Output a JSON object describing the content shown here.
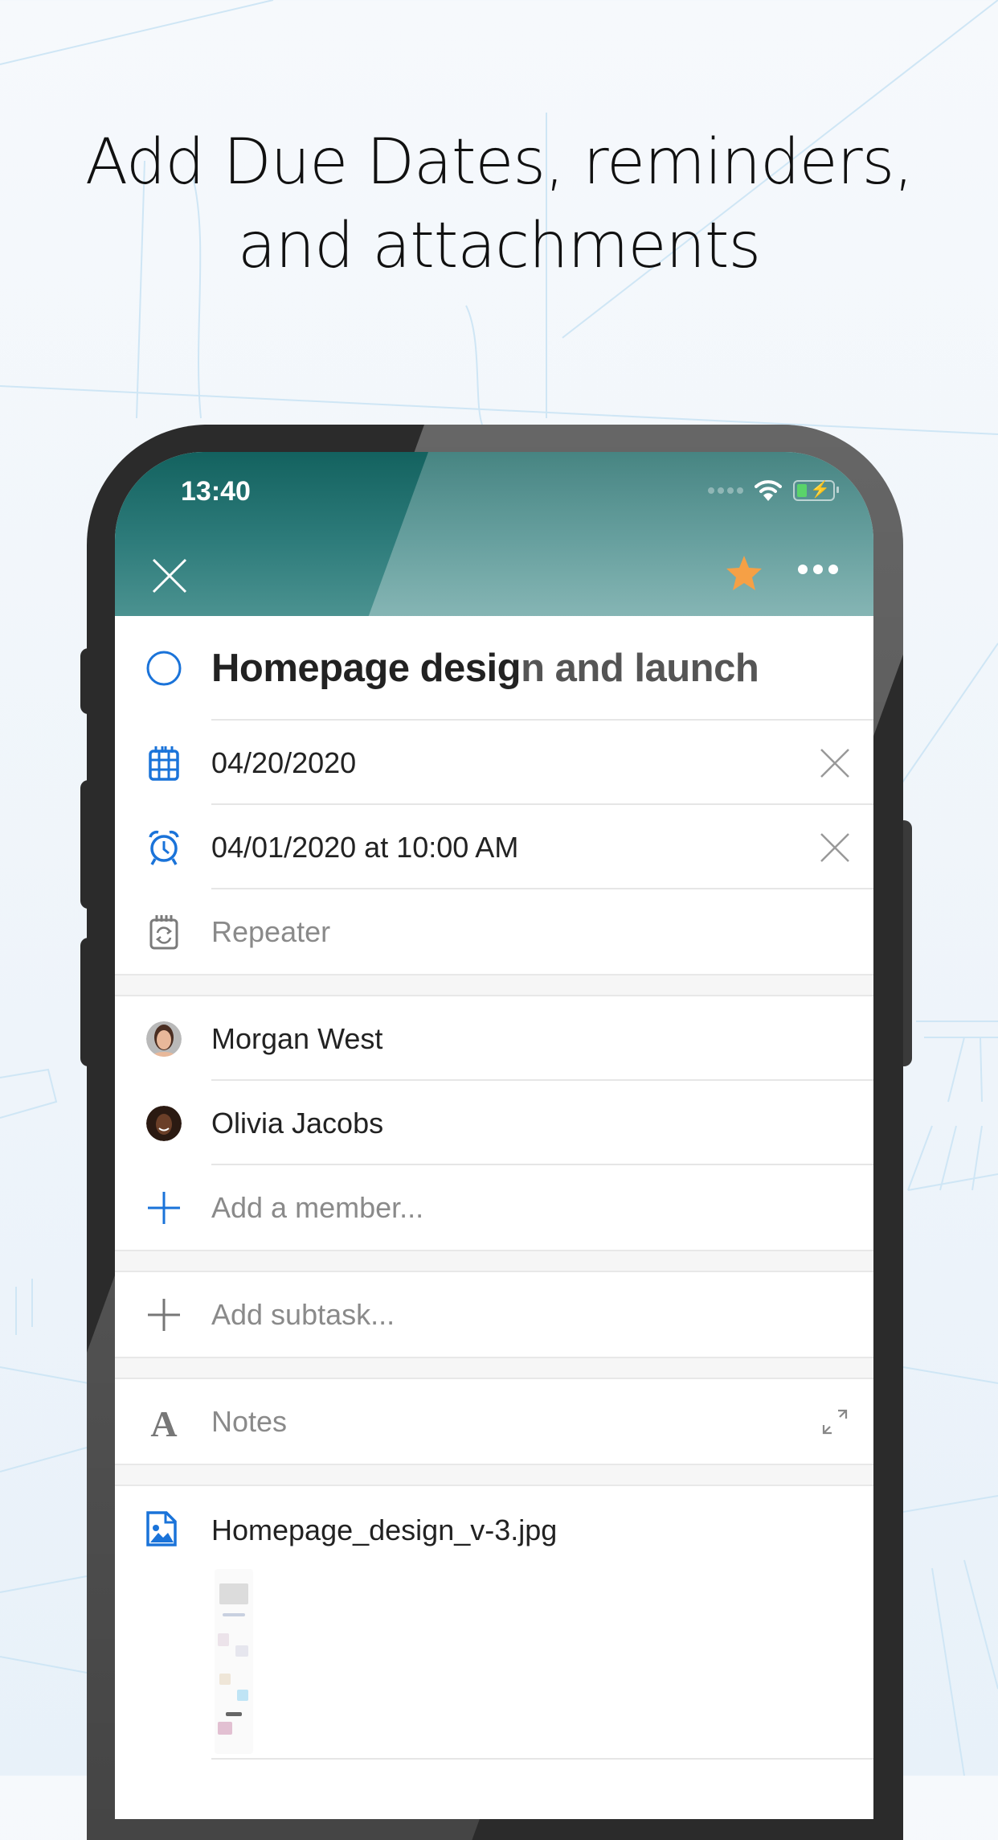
{
  "headline": {
    "line1": "Add Due Dates, reminders,",
    "line2": "and attachments"
  },
  "status_bar": {
    "time": "13:40",
    "icons": [
      "signal-dots-icon",
      "wifi-icon",
      "battery-charging-icon"
    ]
  },
  "toolbar": {
    "close_icon": "close-icon",
    "star_icon": "star-icon",
    "more_icon": "more-icon",
    "star_color": "#f6a045"
  },
  "task": {
    "title_main": "Homepage desig",
    "title_rest": "n and launch",
    "complete_icon": "circle-checkbox-icon",
    "accent_color": "#1a73d9"
  },
  "due_date": {
    "icon": "calendar-icon",
    "value": "04/20/2020"
  },
  "reminder": {
    "icon": "alarm-clock-icon",
    "value": "04/01/2020 at 10:00 AM"
  },
  "repeater": {
    "icon": "repeat-calendar-icon",
    "label": "Repeater"
  },
  "members": [
    {
      "name": "Morgan West",
      "avatar": "avatar-morgan-west"
    },
    {
      "name": "Olivia Jacobs",
      "avatar": "avatar-olivia-jacobs"
    }
  ],
  "add_member": {
    "placeholder": "Add a member..."
  },
  "add_subtask": {
    "placeholder": "Add subtask..."
  },
  "notes": {
    "label": "Notes",
    "expand_icon": "expand-icon"
  },
  "attachment": {
    "icon": "image-file-icon",
    "filename": "Homepage_design_v-3.jpg"
  }
}
